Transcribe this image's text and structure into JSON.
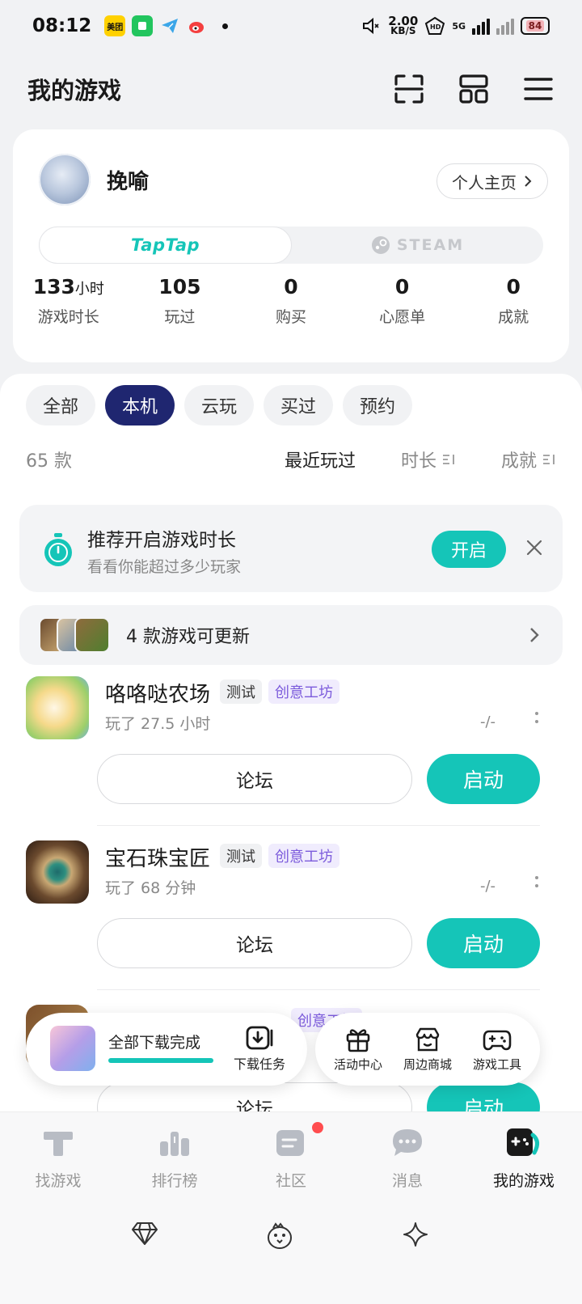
{
  "status_bar": {
    "time": "08:12",
    "apps": [
      {
        "name": "meituan-icon",
        "label": "美团",
        "color": "#ffd100"
      },
      {
        "name": "wechat-icon",
        "label": "",
        "color": "#22c55e"
      },
      {
        "name": "telegram-icon",
        "label": "",
        "color": "#3ba6e8"
      },
      {
        "name": "weibo-icon",
        "label": "",
        "color": "#f43f3f"
      }
    ],
    "net_speed_value": "2.00",
    "net_speed_unit": "KB/S",
    "network": "5G",
    "battery": "84"
  },
  "header": {
    "title": "我的游戏"
  },
  "profile": {
    "username": "挽喻",
    "profile_button": "个人主页",
    "platforms": [
      "TapTap",
      "STEAM"
    ],
    "stats": [
      {
        "value": "133",
        "unit": "小时",
        "label": "游戏时长"
      },
      {
        "value": "105",
        "unit": "",
        "label": "玩过"
      },
      {
        "value": "0",
        "unit": "",
        "label": "购买"
      },
      {
        "value": "0",
        "unit": "",
        "label": "心愿单"
      },
      {
        "value": "0",
        "unit": "",
        "label": "成就"
      }
    ]
  },
  "filters": {
    "chips": [
      "全部",
      "本机",
      "云玩",
      "买过",
      "预约"
    ],
    "active": "本机"
  },
  "sort": {
    "count": "65 款",
    "options": [
      "最近玩过",
      "时长",
      "成就"
    ]
  },
  "promo": {
    "title": "推荐开启游戏时长",
    "subtitle": "看看你能超过多少玩家",
    "button": "开启"
  },
  "updates": {
    "text": "4 款游戏可更新"
  },
  "games": [
    {
      "name": "咯咯哒农场",
      "tags": [
        "测试",
        "创意工坊"
      ],
      "played": "玩了 27.5 小时",
      "rating": "-/-",
      "forum": "论坛",
      "start": "启动"
    },
    {
      "name": "宝石珠宝匠",
      "tags": [
        "测试",
        "创意工坊"
      ],
      "played": "玩了 68 分钟",
      "rating": "-/-",
      "forum": "论坛",
      "start": "启动"
    },
    {
      "name": "",
      "tags": [
        "",
        "创意工坊"
      ],
      "played": "",
      "rating": "",
      "forum": "论坛",
      "start": "启动"
    }
  ],
  "download_bar": {
    "text": "全部下载完成",
    "progress": 1.0,
    "task_label": "下载任务"
  },
  "tools": [
    {
      "icon": "gift-icon",
      "label": "活动中心"
    },
    {
      "icon": "store-icon",
      "label": "周边商城"
    },
    {
      "icon": "gamepad-icon",
      "label": "游戏工具"
    }
  ],
  "bottom_nav": [
    {
      "icon": "taptap-logo-icon",
      "label": "找游戏"
    },
    {
      "icon": "ranking-icon",
      "label": "排行榜"
    },
    {
      "icon": "community-icon",
      "label": "社区"
    },
    {
      "icon": "message-icon",
      "label": "消息"
    },
    {
      "icon": "my-games-icon",
      "label": "我的游戏"
    }
  ],
  "colors": {
    "accent": "#15c5b8",
    "chip_active": "#1f2670",
    "tag_purple": "#7c5bdc",
    "badge_red": "#ff4d4f"
  }
}
